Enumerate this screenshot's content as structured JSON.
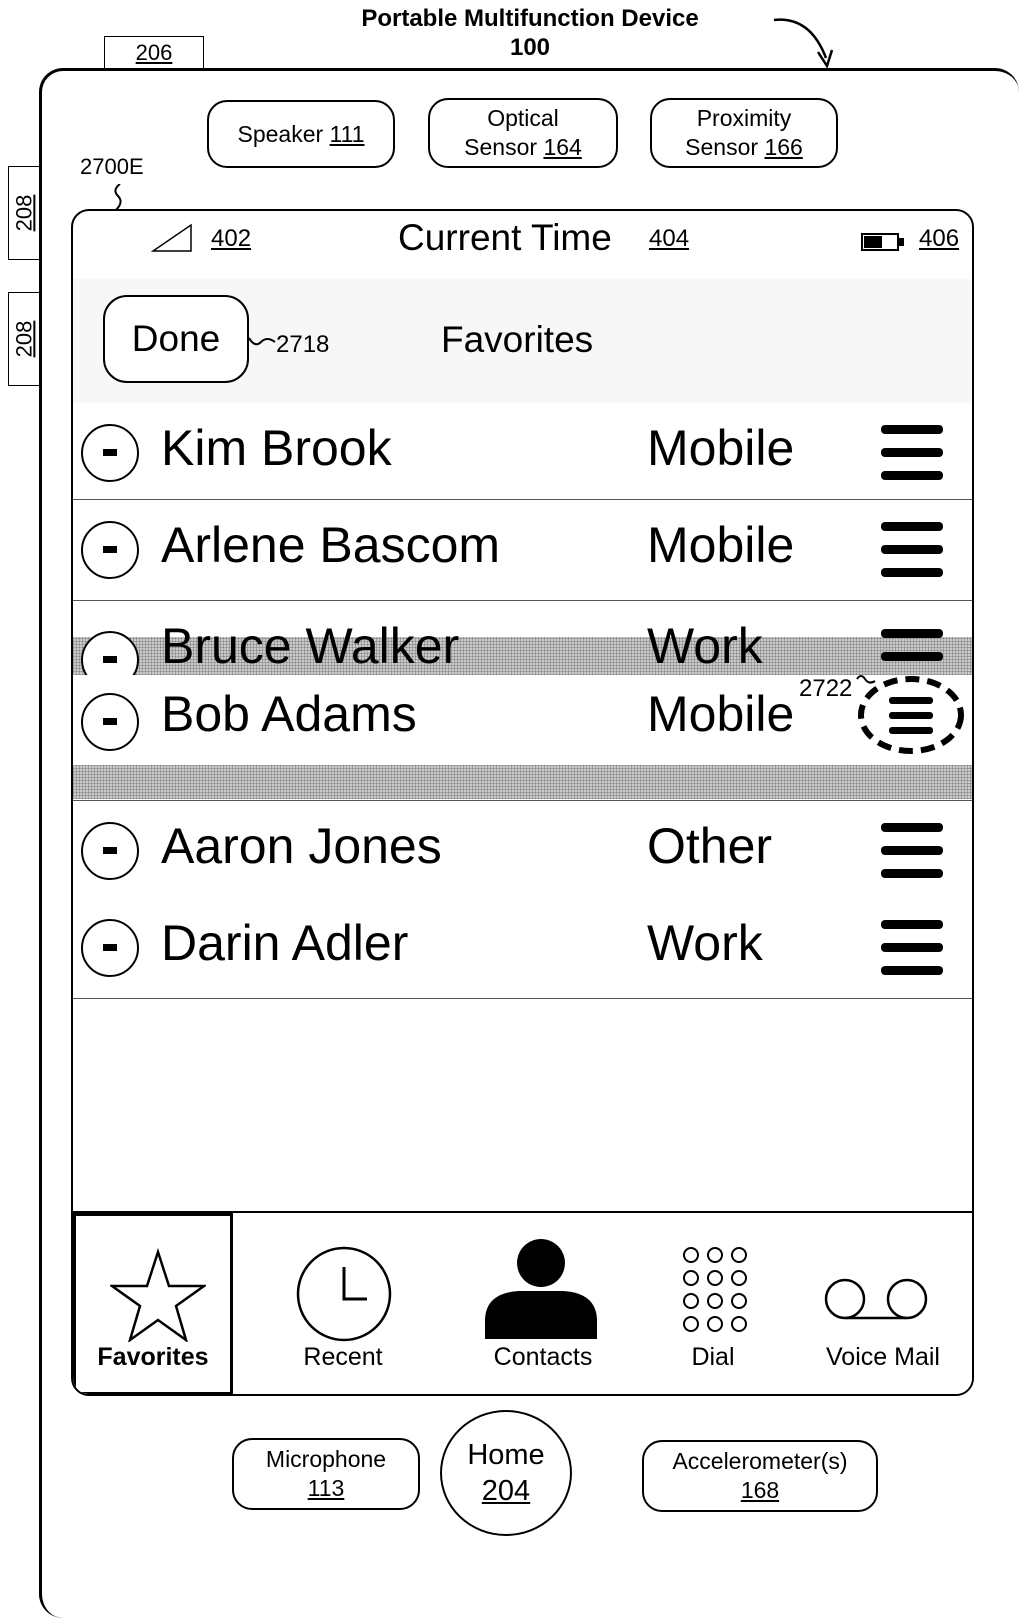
{
  "header": {
    "title_line1": "Portable Multifunction Device",
    "title_line2": "100"
  },
  "hardware": {
    "button_206": "206",
    "button_208_top": "208",
    "button_208_bottom": "208",
    "speaker_label": "Speaker",
    "speaker_ref": "111",
    "optical_label": "Optical",
    "optical_label2": "Sensor",
    "optical_ref": "164",
    "proximity_label": "Proximity",
    "proximity_label2": "Sensor",
    "proximity_ref": "166",
    "microphone_label": "Microphone",
    "microphone_ref": "113",
    "home_label": "Home",
    "home_ref": "204",
    "accelerometer_label": "Accelerometer(s)",
    "accelerometer_ref": "168"
  },
  "screen_ref": "2700E",
  "status_bar": {
    "signal_ref": "402",
    "time_label": "Current Time",
    "time_ref": "404",
    "battery_ref": "406",
    "icons": [
      "signal-icon",
      "battery-icon"
    ]
  },
  "nav": {
    "done_label": "Done",
    "done_ref": "2718",
    "title": "Favorites"
  },
  "favorites": [
    {
      "name": "Kim Brook",
      "type": "Mobile"
    },
    {
      "name": "Arlene Bascom",
      "type": "Mobile"
    },
    {
      "name": "Bruce Walker",
      "type": "Work"
    },
    {
      "name": "Bob Adams",
      "type": "Mobile"
    },
    {
      "name": "Aaron Jones",
      "type": "Other"
    },
    {
      "name": "Darin Adler",
      "type": "Work"
    }
  ],
  "drag_ref": "2722",
  "tabs": [
    {
      "label": "Favorites",
      "icon": "star-icon",
      "selected": true
    },
    {
      "label": "Recent",
      "icon": "clock-icon"
    },
    {
      "label": "Contacts",
      "icon": "person-icon"
    },
    {
      "label": "Dial",
      "icon": "keypad-icon"
    },
    {
      "label": "Voice Mail",
      "icon": "voicemail-icon"
    }
  ]
}
